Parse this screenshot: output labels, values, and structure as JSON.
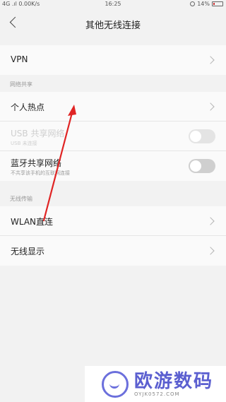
{
  "status_bar": {
    "left": "4G .ıl 0.00K/s",
    "time": "16:25",
    "battery": "14%"
  },
  "header": {
    "title": "其他无线连接"
  },
  "sections": {
    "top_items": [
      {
        "label": "VPN"
      }
    ],
    "network_sharing": {
      "header": "网络共享",
      "hotspot": {
        "label": "个人热点"
      },
      "usb": {
        "label": "USB 共享网络",
        "subtitle": "USB 未连接"
      },
      "bluetooth": {
        "label": "蓝牙共享网络",
        "subtitle": "不共享该手机的互联网连接"
      }
    },
    "wireless_transfer": {
      "header": "无线传输",
      "wlan_direct": {
        "label": "WLAN直连"
      },
      "wireless_display": {
        "label": "无线显示"
      }
    }
  },
  "watermark": {
    "brand": "欧游数码",
    "url": "OYJK0572.COM"
  },
  "colors": {
    "annotation_arrow": "#e02424",
    "watermark_accent": "#5b5fd0"
  }
}
